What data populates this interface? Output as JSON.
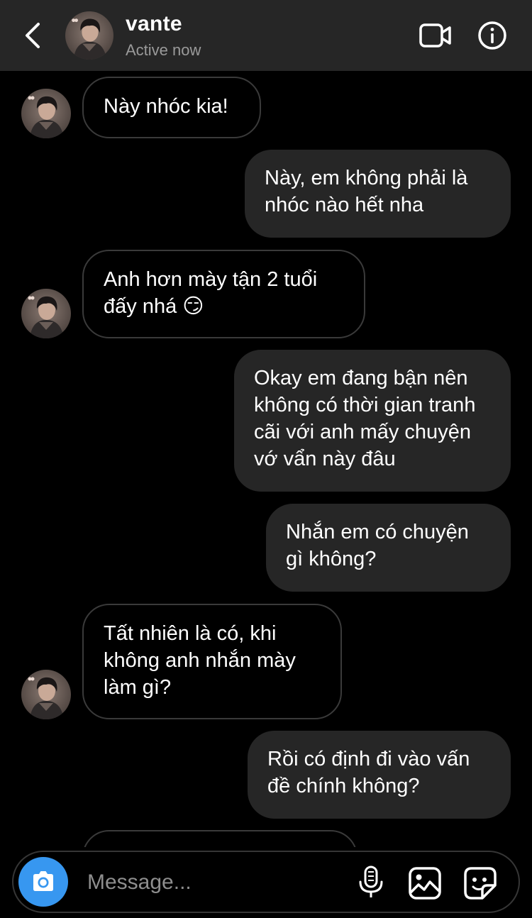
{
  "header": {
    "contact_name": "vante",
    "status": "Active now",
    "icons": {
      "back": "chevron-left-icon",
      "video": "video-call-icon",
      "info": "info-icon"
    }
  },
  "messages": [
    {
      "sender": "them",
      "text": "Này nhóc kia!"
    },
    {
      "sender": "me",
      "text": "Này, em không phải là nhóc nào hết nha"
    },
    {
      "sender": "them",
      "text": "Anh hơn mày tận 2 tuổi đấy nhá 😏"
    },
    {
      "sender": "me",
      "text": "Okay em đang bận nên không có thời gian tranh cãi với anh mấy chuyện vớ vẩn này đâu"
    },
    {
      "sender": "me",
      "text": "Nhắn em có chuyện gì không?"
    },
    {
      "sender": "them",
      "text": "Tất nhiên là có, khi không anh nhắn mày làm gì?"
    },
    {
      "sender": "me",
      "text": "Rồi có định đi vào vấn đề chính không?"
    },
    {
      "sender": "them",
      "text": ""
    }
  ],
  "composer": {
    "placeholder": "Message...",
    "icons": {
      "camera": "camera-icon",
      "mic": "microphone-icon",
      "gallery": "gallery-icon",
      "sticker": "sticker-icon"
    }
  },
  "colors": {
    "header_bg": "#262626",
    "sent_bubble": "#262626",
    "received_border": "#3a3a3a",
    "accent": "#3797f0",
    "muted_text": "#9a9a9a"
  }
}
